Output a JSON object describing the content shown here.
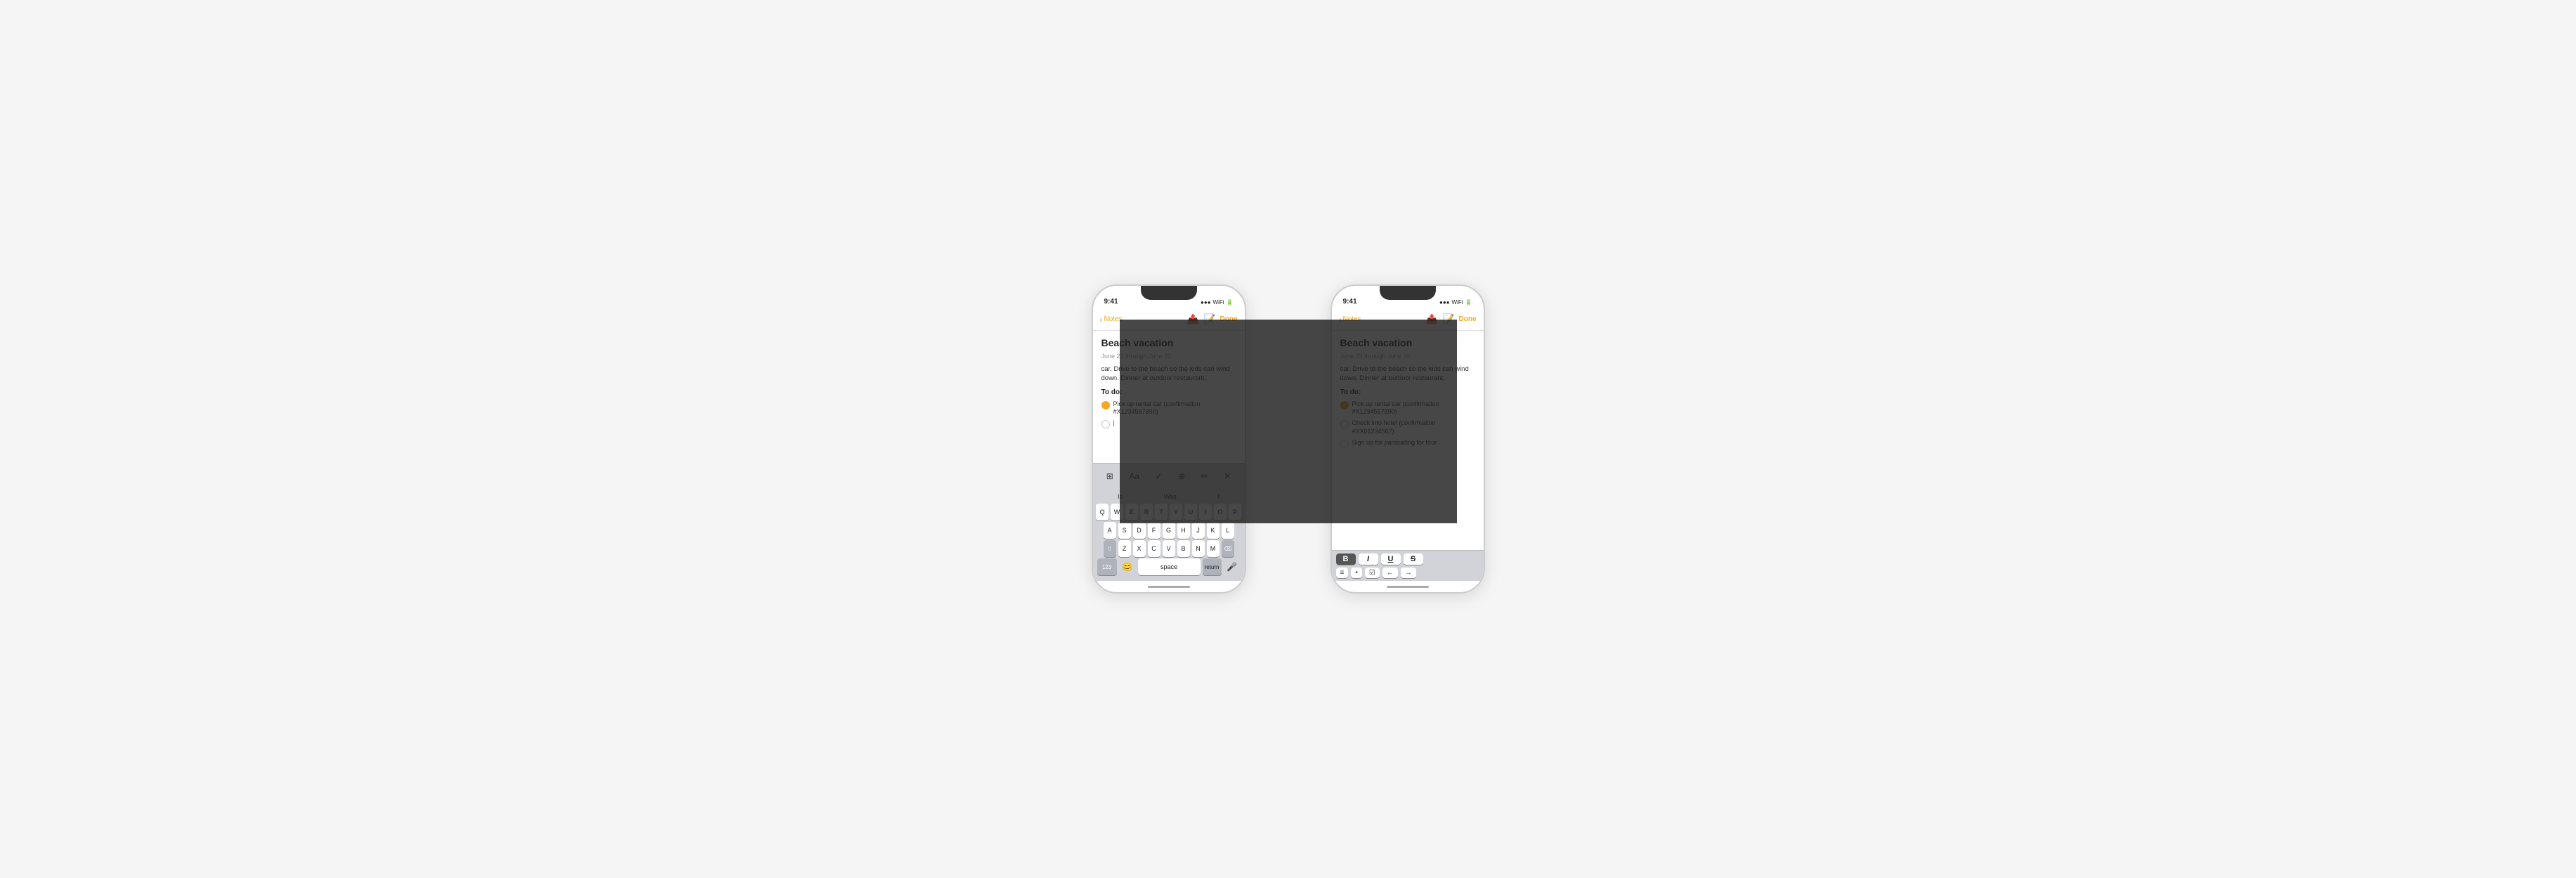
{
  "scene": {
    "background": "#f5f5f5"
  },
  "phone_left": {
    "status": {
      "time": "9:41",
      "signal": "●●●",
      "wifi": "▲",
      "battery": "▮"
    },
    "nav": {
      "back_label": "Notes",
      "done_label": "Done"
    },
    "note": {
      "title": "Beach vacation",
      "date": "June 23 through June 30.",
      "body": "car. Drive to the beach so the kids can wind down. Dinner at outdoor restaurant.",
      "todo_label": "To do:",
      "items": [
        {
          "done": true,
          "text": "Pick up rental car (confirmation #X1234567890)"
        },
        {
          "done": false,
          "text": ""
        }
      ]
    },
    "format_bar": {
      "icons": [
        "⊞",
        "Aa",
        "✓",
        "⊕",
        "✏",
        "✕"
      ]
    },
    "keyboard": {
      "suggestions": [
        "Is",
        "Was",
        "I"
      ],
      "rows": [
        [
          "Q",
          "W",
          "E",
          "R",
          "T",
          "Y",
          "U",
          "I",
          "O",
          "P"
        ],
        [
          "A",
          "S",
          "D",
          "F",
          "G",
          "H",
          "J",
          "K",
          "L"
        ],
        [
          "⇧",
          "Z",
          "X",
          "C",
          "V",
          "B",
          "N",
          "M",
          "⌫"
        ],
        [
          "123",
          "space",
          "return"
        ]
      ],
      "bottom": [
        "😊",
        "🎤"
      ]
    }
  },
  "phone_right": {
    "status": {
      "time": "9:41",
      "signal": "●●●",
      "wifi": "▲",
      "battery": "▮"
    },
    "nav": {
      "back_label": "Notes",
      "done_label": "Done"
    },
    "note": {
      "title": "Beach vacation",
      "date": "June 23 through June 30.",
      "body": "car. Drive to the beach so the kids can wind down. Dinner at outdoor restaurant.",
      "todo_label": "To do:",
      "items": [
        {
          "done": true,
          "text": "Pick up rental car (confirmation #X1234567890)"
        },
        {
          "done": false,
          "text": "Check into hotel (confirmation #XX01234567)"
        },
        {
          "done": false,
          "text": "Sign up for parasailing for four"
        }
      ]
    },
    "format_bar": {
      "style_buttons": [
        "B",
        "I",
        "U",
        "S"
      ],
      "list_buttons": [
        "≡",
        "•",
        "☑"
      ],
      "indent_buttons": [
        "←",
        "→"
      ]
    }
  }
}
